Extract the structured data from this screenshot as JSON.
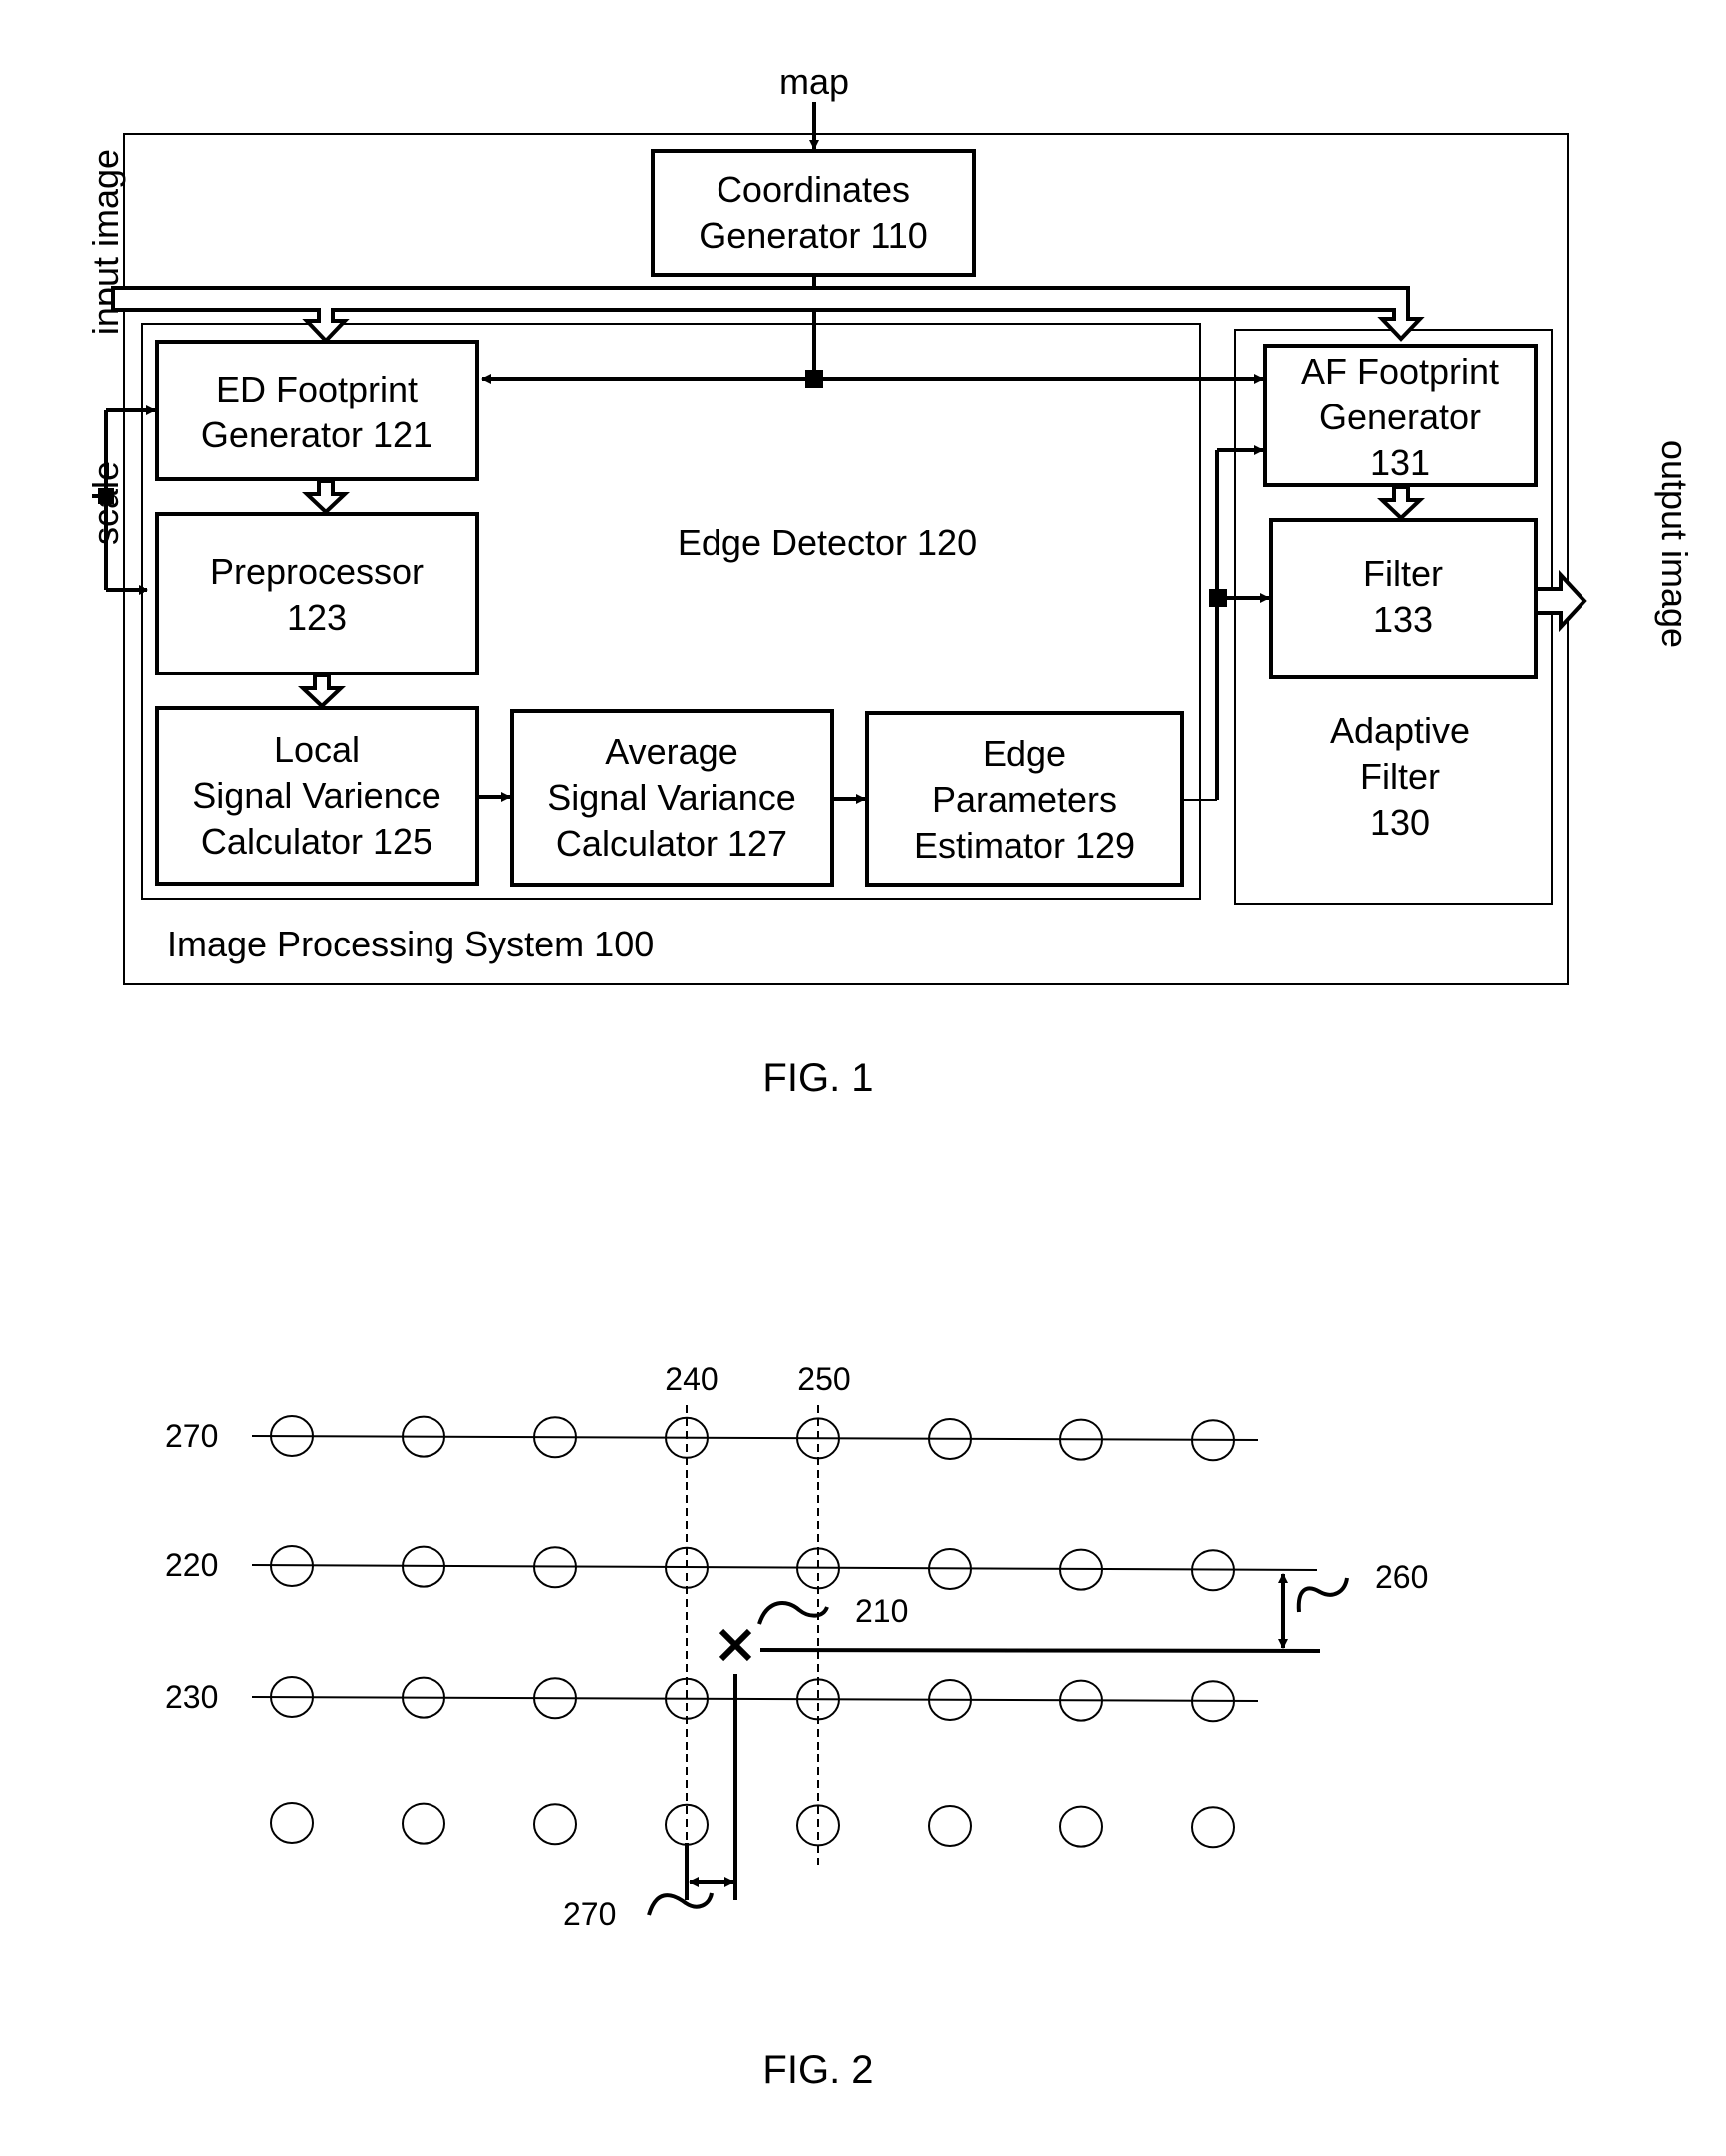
{
  "fig1": {
    "caption": "FIG. 1",
    "inputs": {
      "map": "map",
      "input_image": "input image",
      "scale": "scale",
      "output_image": "output image"
    },
    "system_label": "Image Processing System 100",
    "edge_detector_label": "Edge Detector 120",
    "blocks": {
      "coords": [
        "Coordinates",
        "Generator   110"
      ],
      "ed_footprint": [
        "ED Footprint",
        "Generator   121"
      ],
      "preprocessor": [
        "Preprocessor",
        "123"
      ],
      "local_var": [
        "Local",
        "Signal Varience",
        "Calculator   125"
      ],
      "avg_var": [
        "Average",
        "Signal Variance",
        "Calculator   127"
      ],
      "edge_params": [
        "Edge",
        "Parameters",
        "Estimator   129"
      ],
      "af_footprint": [
        "AF Footprint",
        "Generator",
        "131"
      ],
      "filter": [
        "Filter",
        "133"
      ],
      "adaptive": [
        "Adaptive",
        "Filter",
        "130"
      ]
    }
  },
  "fig2": {
    "caption": "FIG. 2",
    "row_labels": [
      "270",
      "220",
      "230"
    ],
    "column_labels": [
      "240",
      "250"
    ],
    "grid": {
      "rows": 4,
      "columns": 8,
      "lined_rows": 3
    },
    "refs": {
      "point": "210",
      "vertical_offset": "260",
      "horizontal_offset": "270"
    }
  }
}
